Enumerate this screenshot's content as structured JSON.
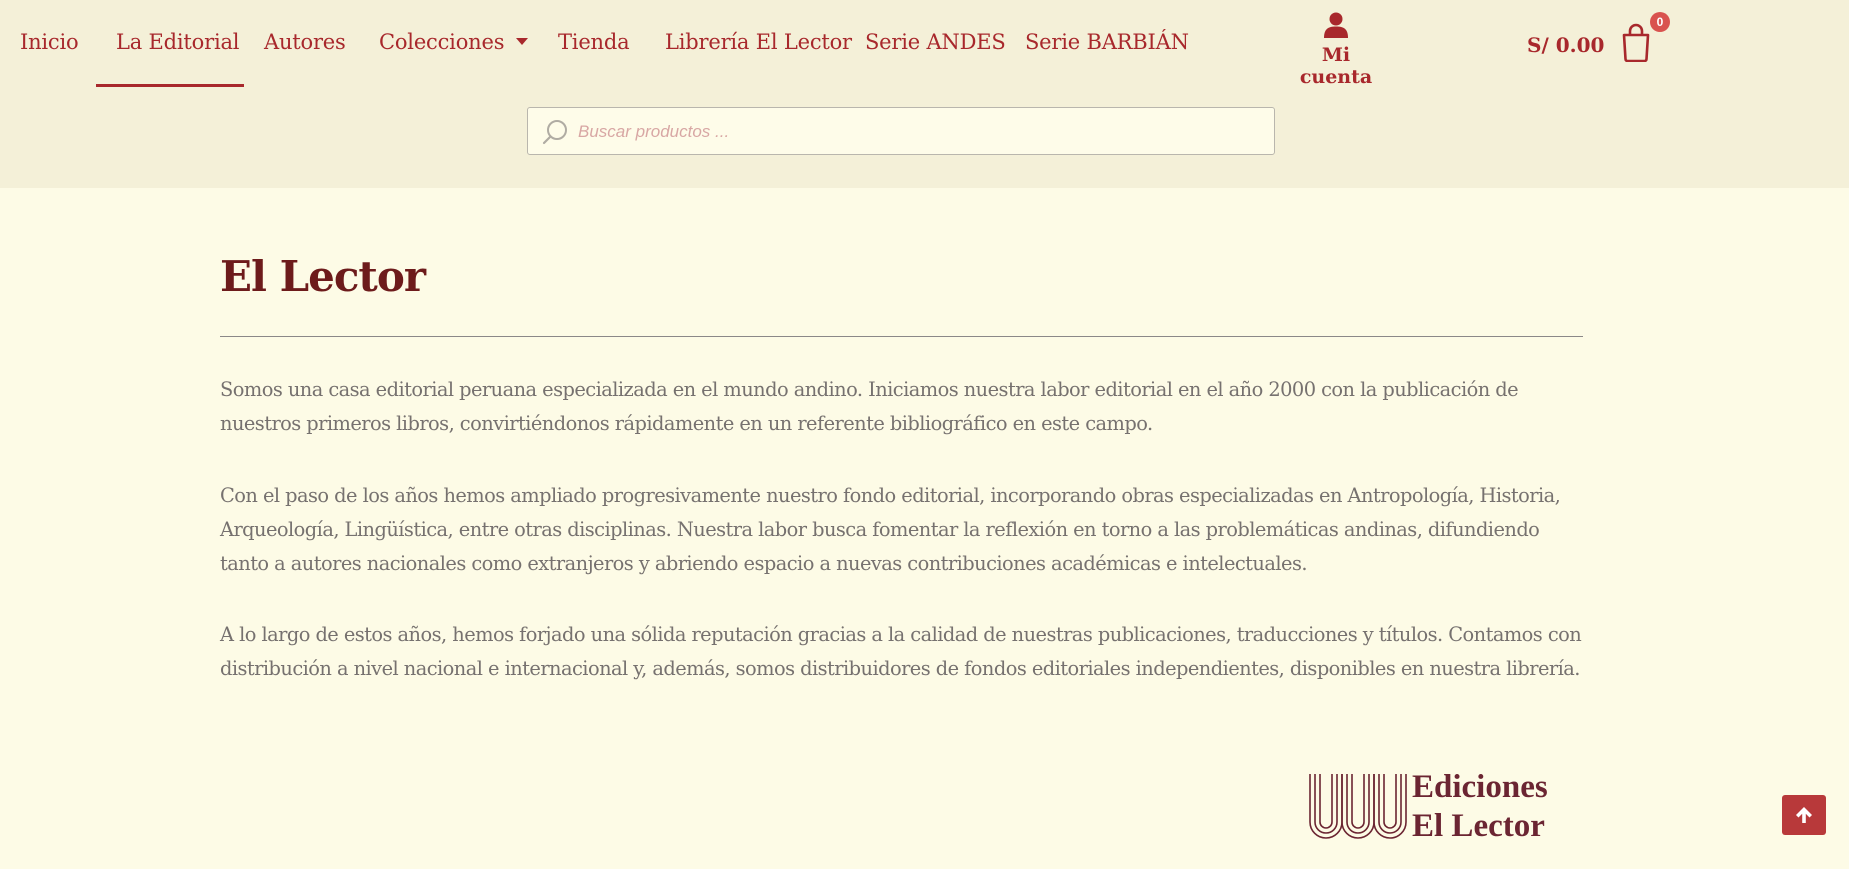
{
  "nav": {
    "items": [
      {
        "label": "Inicio"
      },
      {
        "label": "La Editorial"
      },
      {
        "label": "Autores"
      },
      {
        "label": "Colecciones"
      },
      {
        "label": "Tienda"
      },
      {
        "label": "Librería El Lector"
      },
      {
        "label": "Serie ANDES"
      },
      {
        "label": "Serie BARBIÁN"
      }
    ],
    "active": "La Editorial"
  },
  "account": {
    "label": "Mi cuenta",
    "icon": "user-icon"
  },
  "cart": {
    "total": "S/ 0.00",
    "count": "0",
    "icon": "shopping-bag-icon"
  },
  "search": {
    "placeholder": "Buscar productos ...",
    "icon": "search-icon"
  },
  "main": {
    "title": "El Lector",
    "paragraphs": [
      "Somos una casa editorial peruana especializada en el mundo andino. Iniciamos nuestra labor editorial en el año 2000 con la publicación de nuestros primeros libros, convirtiéndonos rápidamente en un referente bibliográfico en este campo.",
      "Con el paso de los años hemos ampliado progresivamente nuestro fondo editorial, incorporando obras especializadas en Antropología, Historia, Arqueología, Lingüística, entre otras disciplinas. Nuestra labor busca fomentar la reflexión en torno a las problemáticas andinas, difundiendo tanto a autores nacionales como extranjeros y abriendo espacio a nuevas contribuciones académicas e intelectuales.",
      "A lo largo de estos años, hemos forjado una sólida reputación gracias a la calidad de nuestras publicaciones, traducciones y títulos. Contamos con distribución a nivel nacional e internacional y, además, somos distribuidores de fondos editoriales independientes, disponibles en nuestra librería."
    ]
  },
  "logo": {
    "line1": "Ediciones",
    "line2": "El Lector"
  },
  "colors": {
    "accent": "#a8282c",
    "title": "#6d1b1b",
    "header_bg": "#f4f0d8",
    "page_bg": "#fdfbe6"
  }
}
